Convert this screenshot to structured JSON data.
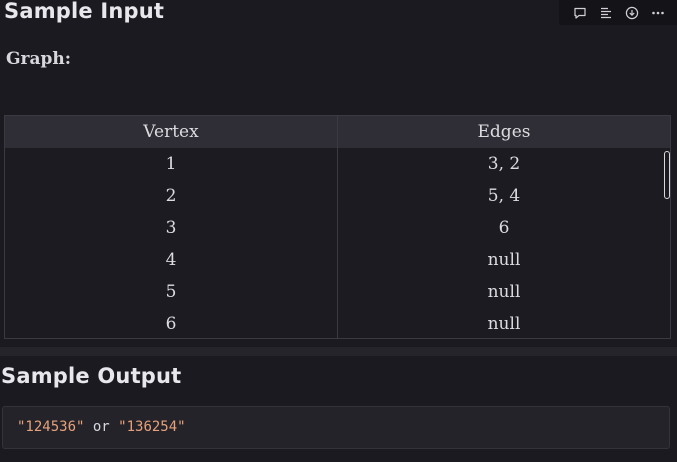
{
  "input_section": {
    "title": "Sample Input"
  },
  "toolbar": {
    "icons": [
      "comment-icon",
      "outline-icon",
      "download-icon",
      "more-icon"
    ]
  },
  "graph": {
    "label": "Graph:",
    "columns": [
      "Vertex",
      "Edges"
    ],
    "rows": [
      [
        "1",
        "3, 2"
      ],
      [
        "2",
        "5, 4"
      ],
      [
        "3",
        "6"
      ],
      [
        "4",
        "null"
      ],
      [
        "5",
        "null"
      ],
      [
        "6",
        "null"
      ]
    ]
  },
  "output_section": {
    "title": "Sample Output",
    "code": {
      "value1": "\"124536\"",
      "separator": " or ",
      "value2": "\"136254\""
    }
  },
  "colors": {
    "background": "#1b1a21",
    "table_header": "#2f2e36",
    "string_literal": "#e7a17a"
  }
}
